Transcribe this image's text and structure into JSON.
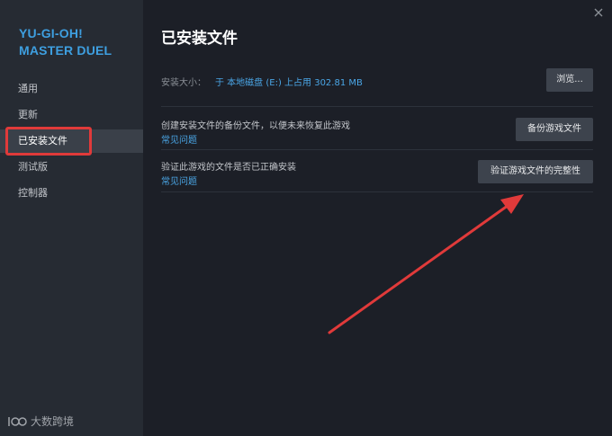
{
  "sidebar": {
    "game_title_line1": "YU-GI-OH!",
    "game_title_line2": "MASTER DUEL",
    "items": [
      {
        "label": "通用"
      },
      {
        "label": "更新"
      },
      {
        "label": "已安装文件"
      },
      {
        "label": "测试版"
      },
      {
        "label": "控制器"
      }
    ],
    "active_index": 2,
    "highlight_color": "#e03a3a"
  },
  "watermark": {
    "text": "大数跨境"
  },
  "main": {
    "title": "已安装文件",
    "install_size": {
      "label": "安装大小：",
      "value": "于 本地磁盘 (E:) 上占用 302.81 MB",
      "browse_button": "浏览..."
    },
    "backup": {
      "description": "创建安装文件的备份文件，以便未来恢复此游戏",
      "faq_link": "常见问题",
      "button": "备份游戏文件"
    },
    "verify": {
      "description": "验证此游戏的文件是否已正确安装",
      "faq_link": "常见问题",
      "button": "验证游戏文件的完整性"
    }
  },
  "colors": {
    "accent_blue": "#4aa6e6",
    "annotation_red": "#e03a3a"
  }
}
